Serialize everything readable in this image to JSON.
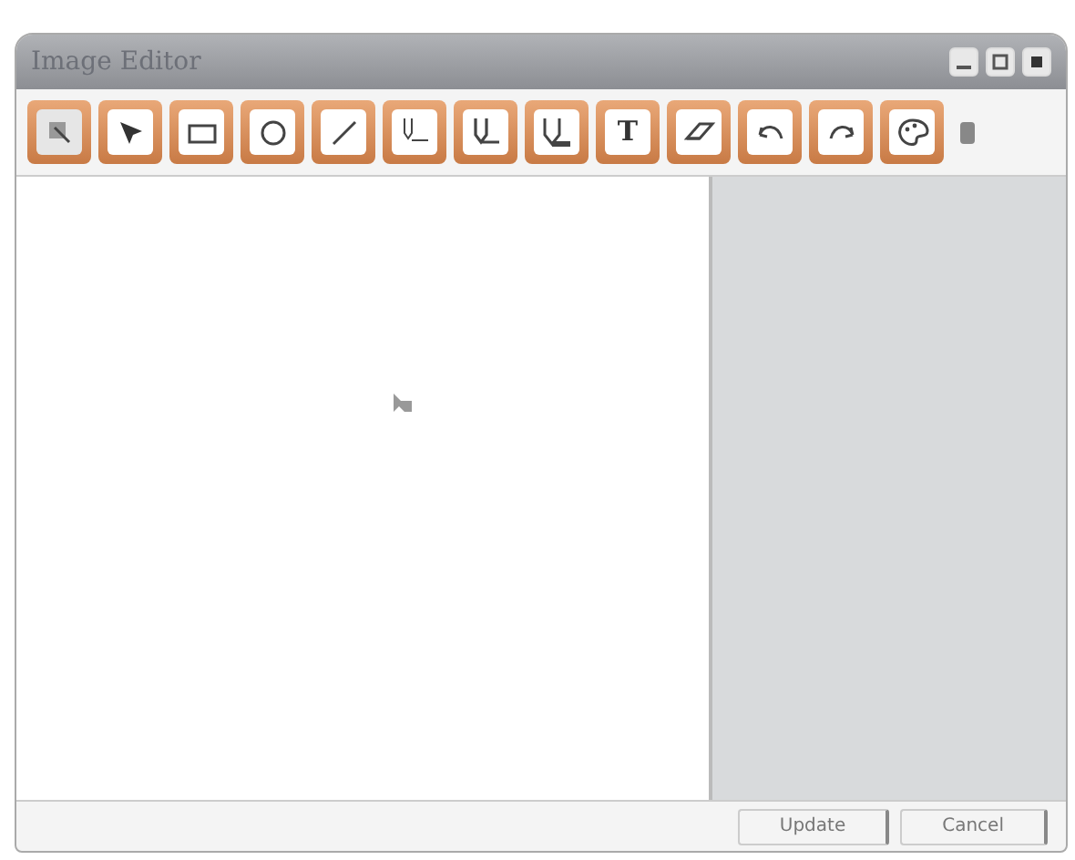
{
  "window": {
    "title": "Image Editor"
  },
  "tools": [
    {
      "kind": "select",
      "selected": true
    },
    {
      "kind": "pointer",
      "selected": false
    },
    {
      "kind": "rectangle",
      "selected": false
    },
    {
      "kind": "ellipse",
      "selected": false
    },
    {
      "kind": "line",
      "selected": false
    },
    {
      "kind": "pencil-thin",
      "selected": false
    },
    {
      "kind": "pencil-medium",
      "selected": false
    },
    {
      "kind": "pencil-thick",
      "selected": false
    },
    {
      "kind": "text",
      "label": "T",
      "selected": false
    },
    {
      "kind": "eraser",
      "selected": false
    },
    {
      "kind": "undo",
      "selected": false
    },
    {
      "kind": "redo",
      "selected": false
    },
    {
      "kind": "palette",
      "selected": false
    }
  ],
  "buttons": [
    "Update",
    "Cancel"
  ]
}
